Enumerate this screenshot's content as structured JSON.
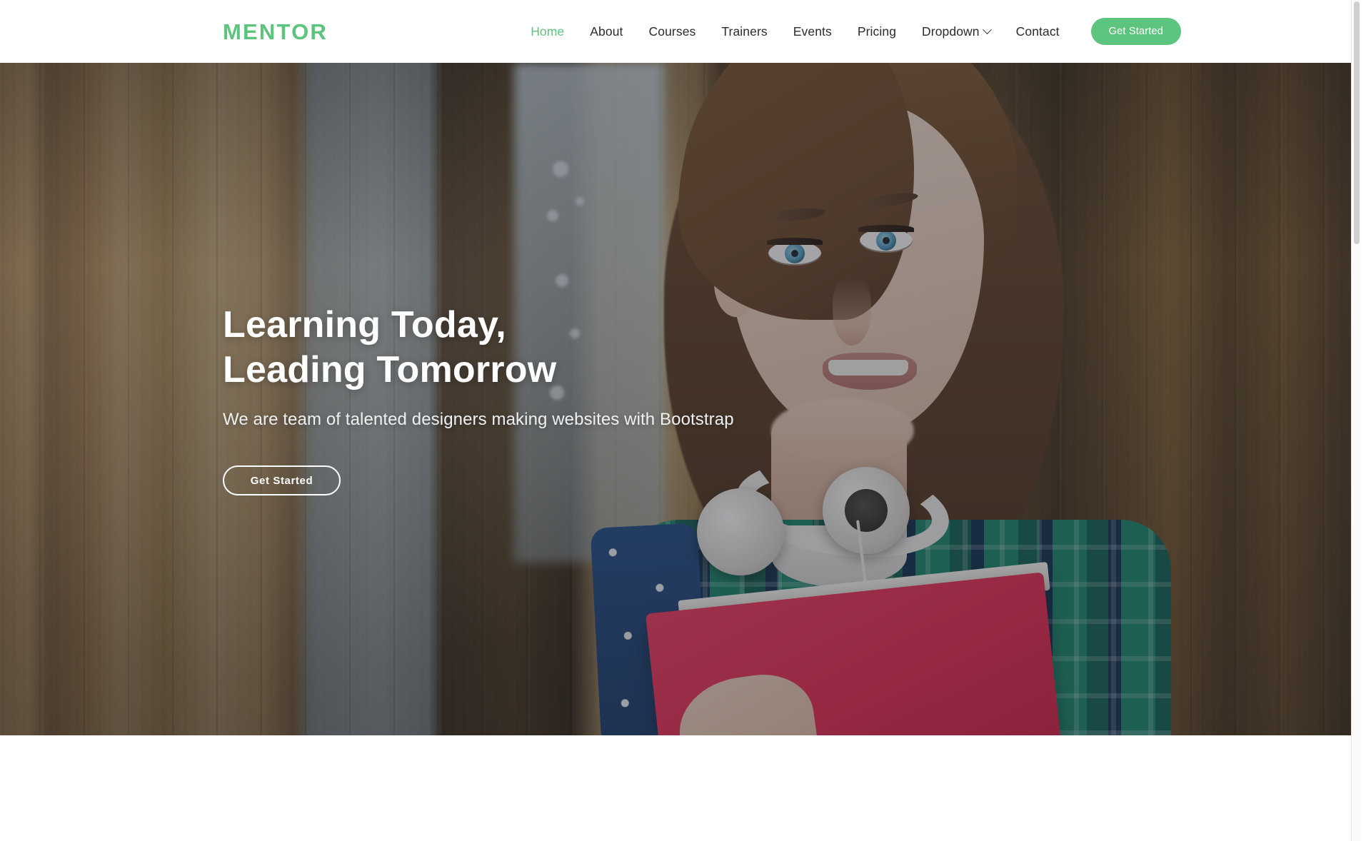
{
  "header": {
    "brand": "MENTOR",
    "nav_items": [
      {
        "label": "Home",
        "active": true,
        "has_dropdown": false
      },
      {
        "label": "About",
        "active": false,
        "has_dropdown": false
      },
      {
        "label": "Courses",
        "active": false,
        "has_dropdown": false
      },
      {
        "label": "Trainers",
        "active": false,
        "has_dropdown": false
      },
      {
        "label": "Events",
        "active": false,
        "has_dropdown": false
      },
      {
        "label": "Pricing",
        "active": false,
        "has_dropdown": false
      },
      {
        "label": "Dropdown",
        "active": false,
        "has_dropdown": true
      },
      {
        "label": "Contact",
        "active": false,
        "has_dropdown": false
      }
    ],
    "cta_label": "Get Started",
    "icons": {
      "dropdown_chevron": "chevron-down-icon"
    }
  },
  "hero": {
    "title_line1": "Learning Today,",
    "title_line2": "Leading Tomorrow",
    "subtitle": "We are team of talented designers making websites with Bootstrap",
    "cta_label": "Get Started",
    "background_description": "Smiling student with white headphones holding a pink folder in front of a wooden plank wall"
  },
  "colors": {
    "accent_green": "#5cc47c",
    "nav_text": "#2b2b2b",
    "hero_text": "#ffffff",
    "hero_subtitle": "#eef0f2",
    "page_background": "#ffffff",
    "hero_overlay": "rgba(40,42,50,0.42)",
    "folder_pink": "#e5264f",
    "shirt_green": "#136b58"
  }
}
